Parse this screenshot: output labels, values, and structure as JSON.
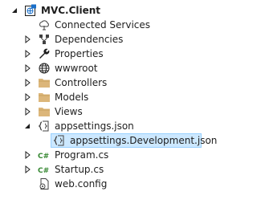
{
  "solution_explorer": {
    "project": {
      "label": "MVC.Client",
      "icon": "web-project-icon"
    },
    "items": [
      {
        "label": "Connected Services",
        "icon": "connected-services-icon"
      },
      {
        "label": "Dependencies",
        "icon": "dependencies-icon"
      },
      {
        "label": "Properties",
        "icon": "wrench-icon"
      },
      {
        "label": "wwwroot",
        "icon": "globe-icon"
      },
      {
        "label": "Controllers",
        "icon": "folder-icon"
      },
      {
        "label": "Models",
        "icon": "folder-icon"
      },
      {
        "label": "Views",
        "icon": "folder-icon"
      },
      {
        "label": "appsettings.json",
        "icon": "json-file-icon"
      },
      {
        "label": "appsettings.Development.json",
        "icon": "json-file-icon"
      },
      {
        "label": "Program.cs",
        "icon": "csharp-file-icon"
      },
      {
        "label": "Startup.cs",
        "icon": "csharp-file-icon"
      },
      {
        "label": "web.config",
        "icon": "config-file-icon"
      }
    ]
  }
}
